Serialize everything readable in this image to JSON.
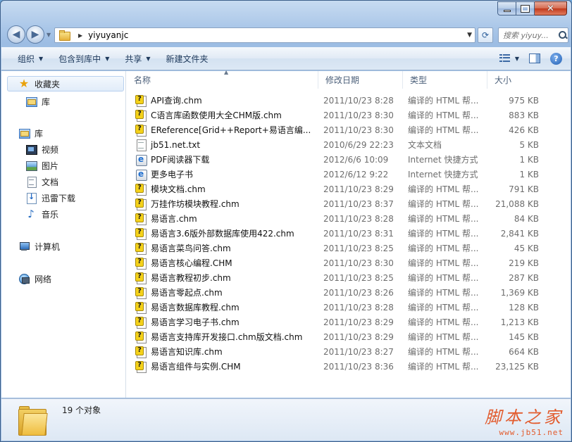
{
  "window": {
    "caption": {
      "minimize": "—",
      "maximize": "",
      "close": "✕"
    }
  },
  "navbar": {
    "back": "◀",
    "forward": "▶",
    "address": {
      "path": "yiyuyanjc"
    },
    "search": {
      "placeholder": "搜索 yiyuy..."
    }
  },
  "toolbar": {
    "organize": "组织",
    "include_in_library": "包含到库中",
    "share": "共享",
    "new_folder": "新建文件夹",
    "help": "?"
  },
  "sidebar": {
    "favorites": "收藏夹",
    "favorites_library": "库",
    "libraries": "库",
    "library_items": [
      "视频",
      "图片",
      "文档",
      "迅雷下载",
      "音乐"
    ],
    "computer": "计算机",
    "network": "网络"
  },
  "columns": {
    "name": "名称",
    "date": "修改日期",
    "type": "类型",
    "size": "大小"
  },
  "files": [
    {
      "name": "API查询.chm",
      "date": "2011/10/23 8:28",
      "type": "编译的 HTML 帮...",
      "size": "975 KB",
      "icon": "chm-help-icon"
    },
    {
      "name": "C语言库函数使用大全CHM版.chm",
      "date": "2011/10/23 8:30",
      "type": "编译的 HTML 帮...",
      "size": "883 KB",
      "icon": "chm-help-icon"
    },
    {
      "name": "EReference[Grid++Report+易语言编...",
      "date": "2011/10/23 8:30",
      "type": "编译的 HTML 帮...",
      "size": "426 KB",
      "icon": "chm-help-icon"
    },
    {
      "name": "jb51.net.txt",
      "date": "2010/6/29 22:23",
      "type": "文本文档",
      "size": "5 KB",
      "icon": "text-file-icon"
    },
    {
      "name": "PDF阅读器下载",
      "date": "2012/6/6 10:09",
      "type": "Internet 快捷方式",
      "size": "1 KB",
      "icon": "internet-shortcut-icon"
    },
    {
      "name": "更多电子书",
      "date": "2012/6/12 9:22",
      "type": "Internet 快捷方式",
      "size": "1 KB",
      "icon": "internet-shortcut-icon"
    },
    {
      "name": "模块文档.chm",
      "date": "2011/10/23 8:29",
      "type": "编译的 HTML 帮...",
      "size": "791 KB",
      "icon": "chm-help-icon"
    },
    {
      "name": "万挂作坊模块教程.chm",
      "date": "2011/10/23 8:37",
      "type": "编译的 HTML 帮...",
      "size": "21,088 KB",
      "icon": "chm-help-icon"
    },
    {
      "name": "易语言.chm",
      "date": "2011/10/23 8:28",
      "type": "编译的 HTML 帮...",
      "size": "84 KB",
      "icon": "chm-help-icon"
    },
    {
      "name": "易语言3.6版外部数据库使用422.chm",
      "date": "2011/10/23 8:31",
      "type": "编译的 HTML 帮...",
      "size": "2,841 KB",
      "icon": "chm-help-icon"
    },
    {
      "name": "易语言菜鸟问答.chm",
      "date": "2011/10/23 8:25",
      "type": "编译的 HTML 帮...",
      "size": "45 KB",
      "icon": "chm-help-icon"
    },
    {
      "name": "易语言核心编程.CHM",
      "date": "2011/10/23 8:30",
      "type": "编译的 HTML 帮...",
      "size": "219 KB",
      "icon": "chm-help-icon"
    },
    {
      "name": "易语言教程初步.chm",
      "date": "2011/10/23 8:25",
      "type": "编译的 HTML 帮...",
      "size": "287 KB",
      "icon": "chm-help-icon"
    },
    {
      "name": "易语言零起点.chm",
      "date": "2011/10/23 8:26",
      "type": "编译的 HTML 帮...",
      "size": "1,369 KB",
      "icon": "chm-help-icon"
    },
    {
      "name": "易语言数据库教程.chm",
      "date": "2011/10/23 8:28",
      "type": "编译的 HTML 帮...",
      "size": "128 KB",
      "icon": "chm-help-icon"
    },
    {
      "name": "易语言学习电子书.chm",
      "date": "2011/10/23 8:29",
      "type": "编译的 HTML 帮...",
      "size": "1,213 KB",
      "icon": "chm-help-icon"
    },
    {
      "name": "易语言支持库开发接口.chm版文档.chm",
      "date": "2011/10/23 8:29",
      "type": "编译的 HTML 帮...",
      "size": "145 KB",
      "icon": "chm-help-icon"
    },
    {
      "name": "易语言知识库.chm",
      "date": "2011/10/23 8:27",
      "type": "编译的 HTML 帮...",
      "size": "664 KB",
      "icon": "chm-help-icon"
    },
    {
      "name": "易语言组件与实例.CHM",
      "date": "2011/10/23 8:36",
      "type": "编译的 HTML 帮...",
      "size": "23,125 KB",
      "icon": "chm-help-icon"
    }
  ],
  "status": {
    "item_count": "19 个对象"
  },
  "watermark": {
    "main": "脚本之家",
    "url": "www.jb51.net"
  },
  "colors": {
    "frame": "#9dbde3",
    "toolbar_text": "#1e395b",
    "watermark": "#e25b2d"
  }
}
